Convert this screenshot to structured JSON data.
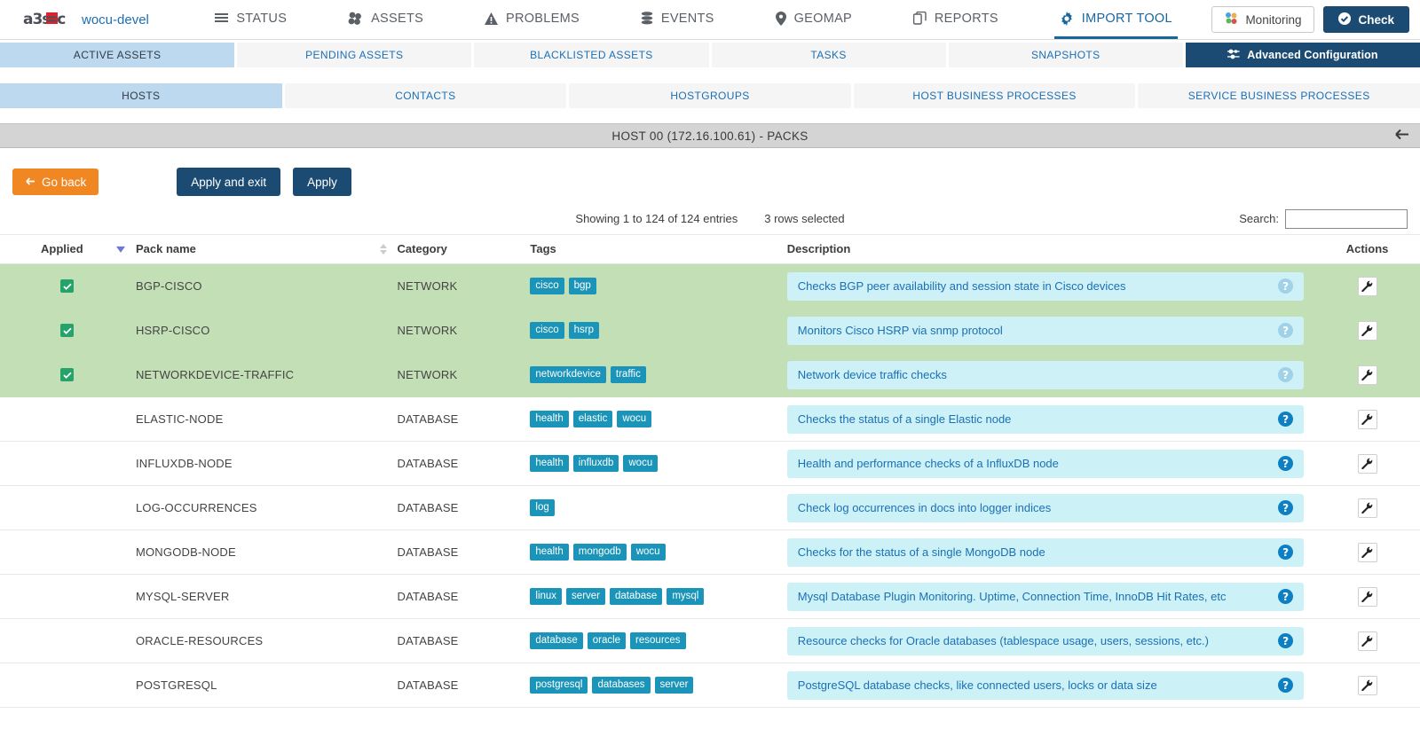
{
  "topnav": {
    "brand": "wocu-devel",
    "logo_text_a": "a3s",
    "logo_text_b": "e",
    "logo_text_c": "c",
    "items": [
      {
        "label": "STATUS",
        "icon": "list-icon",
        "active": false
      },
      {
        "label": "ASSETS",
        "icon": "cubes-icon",
        "active": false
      },
      {
        "label": "PROBLEMS",
        "icon": "warning-icon",
        "active": false
      },
      {
        "label": "EVENTS",
        "icon": "database-icon",
        "active": false
      },
      {
        "label": "GEOMAP",
        "icon": "pin-icon",
        "active": false
      },
      {
        "label": "REPORTS",
        "icon": "copy-icon",
        "active": false
      },
      {
        "label": "IMPORT TOOL",
        "icon": "gear-icon",
        "active": true
      }
    ],
    "monitoring_label": "Monitoring",
    "check_label": "Check"
  },
  "tabs_primary": [
    {
      "label": "ACTIVE ASSETS",
      "active": true,
      "dark": false
    },
    {
      "label": "PENDING ASSETS",
      "active": false,
      "dark": false
    },
    {
      "label": "BLACKLISTED ASSETS",
      "active": false,
      "dark": false
    },
    {
      "label": "TASKS",
      "active": false,
      "dark": false
    },
    {
      "label": "SNAPSHOTS",
      "active": false,
      "dark": false
    },
    {
      "label": "Advanced Configuration",
      "active": false,
      "dark": true
    }
  ],
  "tabs_secondary": [
    {
      "label": "HOSTS",
      "active": true
    },
    {
      "label": "CONTACTS",
      "active": false
    },
    {
      "label": "HOSTGROUPS",
      "active": false
    },
    {
      "label": "HOST BUSINESS PROCESSES",
      "active": false
    },
    {
      "label": "SERVICE BUSINESS PROCESSES",
      "active": false
    }
  ],
  "page": {
    "title": "HOST 00 (172.16.100.61) - PACKS",
    "collapse_icon": "arrow-left-icon"
  },
  "actions": {
    "go_back": "Go back",
    "apply_and_exit": "Apply and exit",
    "apply": "Apply"
  },
  "table_info": {
    "showing": "Showing 1 to 124 of 124 entries",
    "rows_selected": "3 rows selected",
    "search_label": "Search:",
    "search_value": "",
    "search_placeholder": ""
  },
  "columns": {
    "applied": "Applied",
    "pack_name": "Pack name",
    "category": "Category",
    "tags": "Tags",
    "description": "Description",
    "actions": "Actions"
  },
  "colors": {
    "selected_row": "#c3dfb6",
    "tag": "#1a94b8",
    "description_bg": "#ccf2f7",
    "description_text": "#1c6fb5",
    "accent_blue": "#16679e",
    "dark_blue": "#1b4b72",
    "orange": "#f08722",
    "checkbox_green": "#25a36b"
  },
  "rows": [
    {
      "selected": true,
      "applied": true,
      "pack_name": "BGP-CISCO",
      "category": "NETWORK",
      "tags": [
        "cisco",
        "bgp"
      ],
      "description": "Checks BGP peer availability and session state in Cisco devices"
    },
    {
      "selected": true,
      "applied": true,
      "pack_name": "HSRP-CISCO",
      "category": "NETWORK",
      "tags": [
        "cisco",
        "hsrp"
      ],
      "description": "Monitors Cisco HSRP via snmp protocol"
    },
    {
      "selected": true,
      "applied": true,
      "pack_name": "NETWORKDEVICE-TRAFFIC",
      "category": "NETWORK",
      "tags": [
        "networkdevice",
        "traffic"
      ],
      "description": "Network device traffic checks"
    },
    {
      "selected": false,
      "applied": false,
      "pack_name": "ELASTIC-NODE",
      "category": "DATABASE",
      "tags": [
        "health",
        "elastic",
        "wocu"
      ],
      "description": "Checks the status of a single Elastic node"
    },
    {
      "selected": false,
      "applied": false,
      "pack_name": "INFLUXDB-NODE",
      "category": "DATABASE",
      "tags": [
        "health",
        "influxdb",
        "wocu"
      ],
      "description": "Health and performance checks of a InfluxDB node"
    },
    {
      "selected": false,
      "applied": false,
      "pack_name": "LOG-OCCURRENCES",
      "category": "DATABASE",
      "tags": [
        "log"
      ],
      "description": "Check log occurrences in docs into logger indices"
    },
    {
      "selected": false,
      "applied": false,
      "pack_name": "MONGODB-NODE",
      "category": "DATABASE",
      "tags": [
        "health",
        "mongodb",
        "wocu"
      ],
      "description": "Checks for the status of a single MongoDB node"
    },
    {
      "selected": false,
      "applied": false,
      "pack_name": "MYSQL-SERVER",
      "category": "DATABASE",
      "tags": [
        "linux",
        "server",
        "database",
        "mysql"
      ],
      "description": "Mysql Database Plugin Monitoring. Uptime, Connection Time, InnoDB Hit Rates, etc"
    },
    {
      "selected": false,
      "applied": false,
      "pack_name": "ORACLE-RESOURCES",
      "category": "DATABASE",
      "tags": [
        "database",
        "oracle",
        "resources"
      ],
      "description": "Resource checks for Oracle databases (tablespace usage, users, sessions, etc.)"
    },
    {
      "selected": false,
      "applied": false,
      "pack_name": "POSTGRESQL",
      "category": "DATABASE",
      "tags": [
        "postgresql",
        "databases",
        "server"
      ],
      "description": "PostgreSQL database checks, like connected users, locks or data size"
    }
  ],
  "icons": {
    "help": "?",
    "wrench": "wrench-icon",
    "checkmark": "check-icon",
    "go_back_arrow": "arrow-left-icon"
  }
}
